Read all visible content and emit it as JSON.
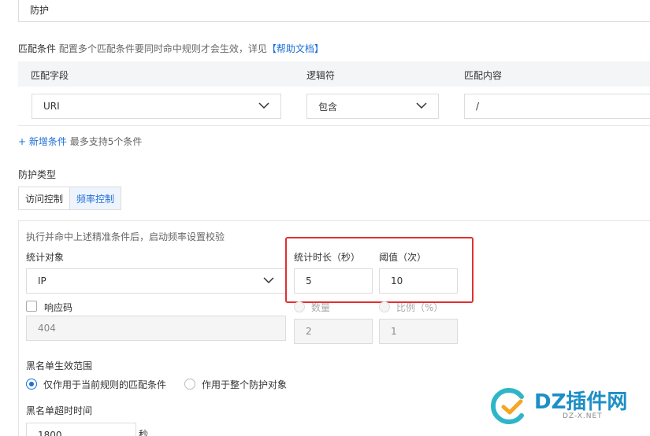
{
  "rule_name": {
    "value": "防护"
  },
  "match": {
    "title": "匹配条件",
    "desc": "配置多个匹配条件要同时命中规则才会生效，详见",
    "help_link": "【帮助文档】",
    "headers": [
      "匹配字段",
      "逻辑符",
      "匹配内容"
    ],
    "row": {
      "field": "URI",
      "operator": "包含",
      "content": "/"
    },
    "add_label": "+ 新增条件",
    "add_hint": "最多支持5个条件"
  },
  "protection": {
    "title": "防护类型",
    "tabs": [
      "访问控制",
      "频率控制"
    ],
    "active_tab": "频率控制"
  },
  "rate": {
    "note": "执行并命中上述精准条件后，启动频率设置校验",
    "target_label": "统计对象",
    "target_value": "IP",
    "duration_label": "统计时长（秒）",
    "duration_value": "5",
    "threshold_label": "阈值（次）",
    "threshold_value": "10",
    "response_code_label": "响应码",
    "response_code_placeholder": "404",
    "count_label": "数量",
    "count_value": "2",
    "ratio_label": "比例（%）",
    "ratio_value": "1"
  },
  "blacklist": {
    "scope_label": "黑名单生效范围",
    "option_current": "仅作用于当前规则的匹配条件",
    "option_all": "作用于整个防护对象",
    "selected": "仅作用于当前规则的匹配条件",
    "timeout_label": "黑名单超时时间",
    "timeout_value": "1800",
    "timeout_unit": "秒"
  },
  "watermark": {
    "text": "DZ插件网",
    "sub": "DZ-X.NET"
  },
  "colors": {
    "accent": "#1c6fd6",
    "highlight_box": "#e03030"
  }
}
